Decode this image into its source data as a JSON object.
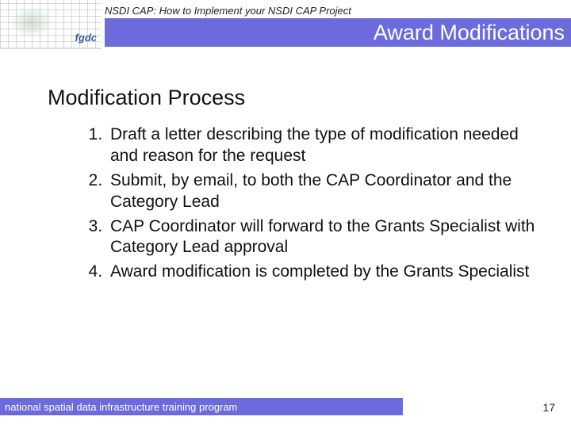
{
  "header": {
    "preheader": "NSDI CAP: How to Implement your NSDI CAP Project",
    "title": "Award Modifications",
    "logo_text": "fgdc"
  },
  "content": {
    "section_title": "Modification Process",
    "steps": [
      "Draft a letter describing the type of modification needed and reason for the request",
      "Submit, by email, to both the CAP Coordinator and the Category Lead",
      "CAP Coordinator will forward to the Grants Specialist with Category Lead approval",
      "Award modification is completed by the Grants Specialist"
    ]
  },
  "footer": {
    "text": "national spatial data infrastructure training program",
    "page_number": "17"
  }
}
